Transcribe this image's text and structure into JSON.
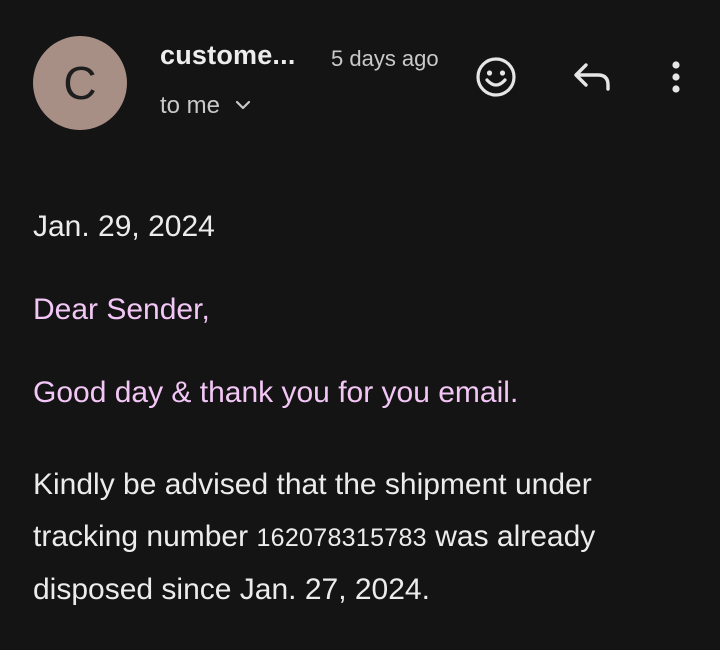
{
  "header": {
    "avatar_letter": "C",
    "sender": "custome...",
    "time": "5 days ago",
    "recipient_label": "to me",
    "icons": [
      "emoji-icon",
      "reply-icon",
      "more-vert-icon",
      "chevron-down-icon"
    ],
    "avatar_color": "#a88f86"
  },
  "body": {
    "date": "Jan. 29, 2024",
    "greeting": "Dear Sender,",
    "thanks": "Good day & thank you for you email.",
    "para_before": "Kindly be advised that the shipment under tracking number ",
    "tracking_number": "162078315783",
    "para_after": "  was already disposed since Jan. 27, 2024.",
    "highlight_color": "#f2c6f5"
  }
}
